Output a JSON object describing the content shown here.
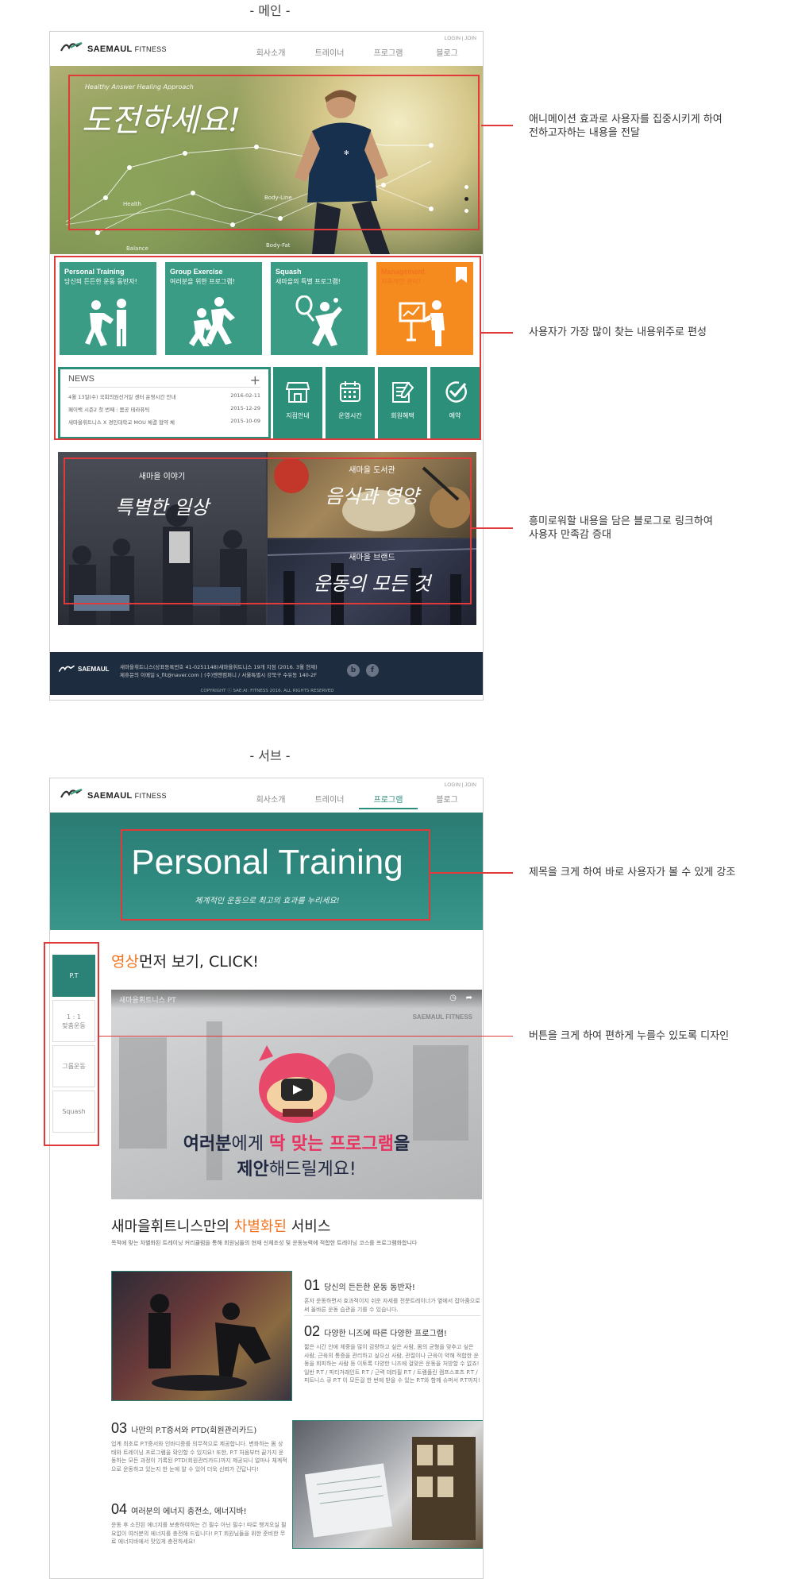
{
  "main_section": {
    "label": "- 메인 -",
    "header": {
      "logo": "SAEMAUL",
      "logo_sub": "FITNESS",
      "top_links": "LOGIN  |  JOIN",
      "nav": [
        "회사소개",
        "트레이너",
        "프로그램",
        "블로그"
      ]
    },
    "hero": {
      "small": "Healthy Answer Healing Approach",
      "big": "도전하세요!",
      "labels": [
        "Health",
        "Balance",
        "Body-Line",
        "Body-Fat"
      ]
    },
    "tiles": [
      {
        "title": "Personal Training",
        "sub": "당신의 든든한 운동 동반자!",
        "icon": "personal-training-icon"
      },
      {
        "title": "Group Exercise",
        "sub": "여러분을 위한 프로그램!",
        "icon": "group-exercise-icon"
      },
      {
        "title": "Squash",
        "sub": "새마을의 특별 프로그램!",
        "icon": "squash-icon"
      },
      {
        "title": "Management",
        "sub": "지속적인 관리!",
        "icon": "management-icon"
      }
    ],
    "news": {
      "title": "NEWS",
      "plus": "+",
      "items": [
        {
          "text": "4월 13일(수) 국회의원선거일 센터 운영시간 안내",
          "date": "2016-02-11"
        },
        {
          "text": "페이백 시즌2 첫 번째 : 몸공 테라퓨틱",
          "date": "2015-12-29"
        },
        {
          "text": "새마을휘트니스 X 경인대학교 MOU 체결 협약 체",
          "date": "2015-10-09"
        }
      ]
    },
    "icon_buttons": [
      {
        "label": "지점안내",
        "icon": "store-icon"
      },
      {
        "label": "운영시간",
        "icon": "calendar-icon"
      },
      {
        "label": "회원혜택",
        "icon": "checklist-icon"
      },
      {
        "label": "예약",
        "icon": "check-circle-icon"
      }
    ],
    "blog": [
      {
        "small": "새마을 이야기",
        "big": "특별한 일상"
      },
      {
        "small": "새마을 도서관",
        "big": "음식과 영양"
      },
      {
        "small": "새마을 브랜드",
        "big": "운동의 모든 것"
      }
    ],
    "footer": {
      "line1": "새마을휘트니스(상표등록번호 41-0251148)새마을휘트니스 19개 지점 (2016. 3월 현재)",
      "line2": "제휴문의 이메일 s_fit@naver.com  |  (주)엔앤컴퍼니 / 서울특별시 강북구 수유동 140-2F",
      "copyright": "COPYRIGHT ⓒ SAE:AI: FITNESS 2016. ALL RIGHTS RESERVED",
      "sns": [
        "blog-icon",
        "facebook-icon"
      ]
    },
    "callouts": [
      "애니메이션 효과로 사용자를 집중시키게 하여\n전하고자하는 내용을 전달",
      "사용자가 가장 많이 찾는 내용위주로 편성",
      "흥미로워할 내용을 담은 블로그로 링크하여\n사용자 만족감 증대"
    ]
  },
  "sub_section": {
    "label": "- 서브 -",
    "header": {
      "logo": "SAEMAUL",
      "logo_sub": "FITNESS",
      "top_links": "LOGIN  |  JOIN",
      "nav": [
        "회사소개",
        "트레이너",
        "프로그램",
        "블로그"
      ],
      "active": "프로그램"
    },
    "visual": {
      "title": "Personal Training",
      "sub": "체계적인 운동으로 최고의 효과를 누리세요!"
    },
    "lnb": [
      "P.T",
      "1 : 1\n맞춤운동",
      "그룹운동",
      "Squash"
    ],
    "video_heading": {
      "accent": "영상",
      "rest": "먼저 보기, CLICK!"
    },
    "video": {
      "title": "새마을휘트니스 PT",
      "watermark": "SAEMAUL FITNESS",
      "line1_a": "여러분",
      "line1_b": "에게 ",
      "line1_c": "딱 맞는 프로그램",
      "line1_d": "을",
      "line2_a": "제안",
      "line2_b": "해드릴게요!"
    },
    "diff": {
      "pre": "새마을휘트니스만의 ",
      "accent": "차별화된",
      "post": " 서비스",
      "desc": "목적에 맞는 차별화된 트레이닝 커리큘럼을 통해 회원님들의 현재 신체조성 및 운동능력에 적합한 트레이닝 코스를 프로그램화합니다"
    },
    "items": [
      {
        "num": "01",
        "pre": "당신의 ",
        "accent": "든든한 운동 동반자!",
        "text": "혼자 운동하면서 효과적이지 쉬운 자세를 전문트레이너가 옆에서 잡아줌으로써 올바른 운동 습관을 기를 수 있습니다."
      },
      {
        "num": "02",
        "pre": "다양한 니즈에 따른 ",
        "accent": "다양한 프로그램!",
        "text": "짧은 시간 안에 체중을 많이 감량하고 싶은 사람, 몸의 균형을 맞추고 싶은 사람, 근육의 통증을 관리하고 싶으신 사람, 관절이나 근육이 약해 적합한 운동을 회피하는 사람 등 이토록 다양한 니즈에 걸맞은 운동을 처방할 수 없죠! 일반 P.T / 피티거래인트 P.T / 근력 테라필 P.T / 트램폴린 캠프스포츠 P.T / 피트니스 큐 P.T 이 모든걸 한 번에 받을 수 있는 P.T와 함께 슈퍼서 P.T까지!"
      },
      {
        "num": "03",
        "pre": "나만의 ",
        "accent": "P.T증서와 PTD(회원관리카드)",
        "text": "업계 최초로 P.T증서와 인바디증를 의무적으로 제공합니다. 변화하는 몸 상태와 트레이닝 프로그램을 확인할 수 있지요! 또한, P.T 처음부터 끝가지 운동하는 모든 과정이 기록된 PTD(회원관리카드)까지 제공되니 얼마나 체계적으로 운동하고 있는지 한 눈에 알 수 있어 더욱 신뢰가 간답니다!"
      },
      {
        "num": "04",
        "pre": "여러분의 에너지 충전소, ",
        "accent": "에너지바!",
        "text": "운동 후 소진된 에너지를 보충하여하는 건 필수 아닌 필수! 따로 챙겨오실 필요없이 여러분의 에너지를 충전해 드립니다! P.T 회원님들을 위한 준비한 무료 에너지바에서 맛있게 충전하세요!"
      }
    ],
    "callouts": [
      "제목을 크게 하여 바로 사용자가 볼 수 있게 강조",
      "버튼을 크게 하여 편하게 누를수 있도록 디자인"
    ]
  },
  "colors": {
    "accent_teal": "#2c8f7a",
    "accent_orange": "#f58a1f",
    "callout_red": "#e13a3a",
    "footer_navy": "#1e2c40"
  }
}
